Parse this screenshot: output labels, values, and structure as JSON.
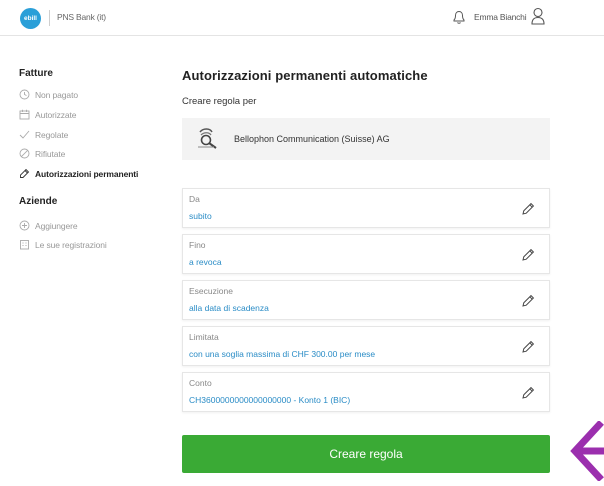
{
  "header": {
    "logo_text": "ebill",
    "bank_name": "PNS Bank (it)",
    "user_name": "Emma Bianchi"
  },
  "sidebar": {
    "bills_title": "Fatture",
    "bills_items": [
      {
        "label": "Non pagato",
        "icon": "clock-icon"
      },
      {
        "label": "Autorizzate",
        "icon": "calendar-icon"
      },
      {
        "label": "Regolate",
        "icon": "checkmark-icon"
      },
      {
        "label": "Rifiutate",
        "icon": "cancel-icon"
      },
      {
        "label": "Autorizzazioni permanenti",
        "icon": "repeat-icon"
      }
    ],
    "companies_title": "Aziende",
    "companies_items": [
      {
        "label": "Aggiungere",
        "icon": "add-icon"
      },
      {
        "label": "Le sue registrazioni",
        "icon": "building-icon"
      }
    ]
  },
  "main": {
    "title": "Autorizzazioni permanenti automatiche",
    "subtitle": "Creare regola per",
    "recipient": "Bellophon Communication (Suisse) AG",
    "fields": [
      {
        "label": "Da",
        "value": "subito"
      },
      {
        "label": "Fino",
        "value": "a revoca"
      },
      {
        "label": "Esecuzione",
        "value": "alla data di scadenza"
      },
      {
        "label": "Limitata",
        "value": "con una soglia massima di CHF 300.00 per mese"
      },
      {
        "label": "Conto",
        "value": "CH3600000000000000000 - Konto 1 (BIC)"
      }
    ],
    "create_button": "Creare regola"
  },
  "colors": {
    "accent_green": "#3aaa35",
    "link_blue": "#2a8cc6",
    "logo_blue": "#2a9fd8",
    "arrow_purple": "#9b2fae"
  }
}
